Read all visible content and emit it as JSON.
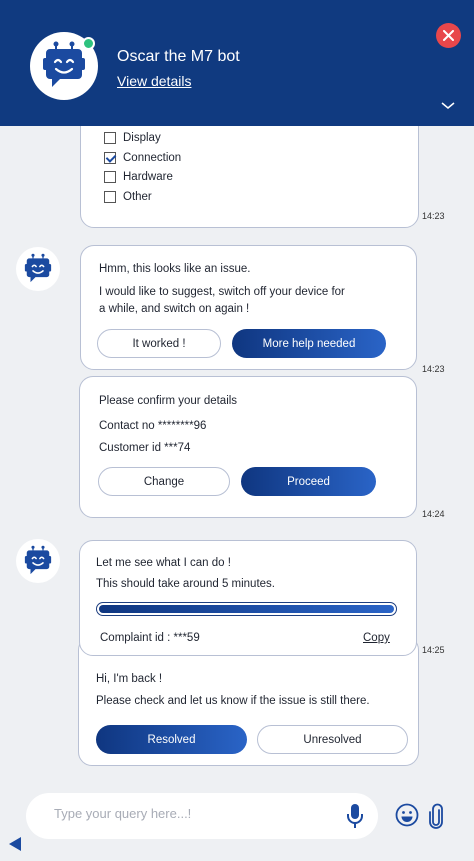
{
  "header": {
    "bot_name": "Oscar the M7 bot",
    "view_details": "View details",
    "online_color": "#2ec27e",
    "close_color": "#e8474b",
    "icons": [
      "bot-avatar-icon",
      "close-icon",
      "chevron-down-icon"
    ]
  },
  "issue_options": {
    "items": [
      {
        "label": "Display",
        "checked": false
      },
      {
        "label": "Connection",
        "checked": true
      },
      {
        "label": "Hardware",
        "checked": false
      },
      {
        "label": "Other",
        "checked": false
      }
    ],
    "time": "14:23"
  },
  "suggestion": {
    "line1": "Hmm, this looks like an issue.",
    "line2": "I would like to suggest, switch off your device for",
    "line3": "a while, and switch on again !",
    "btn_worked": "It worked !",
    "btn_more_help": "More help needed",
    "time": "14:23"
  },
  "confirm": {
    "title": "Please confirm your details",
    "contact": "Contact no ********96",
    "customer": "Customer id ***74",
    "btn_change": "Change",
    "btn_proceed": "Proceed",
    "time": "14:24"
  },
  "progress_msg": {
    "line1": "Let me see what I can do !",
    "line2": "This should take around 5 minutes.",
    "progress": 1.0,
    "complaint": "Complaint id : ***59",
    "copy": "Copy",
    "time": "14:25"
  },
  "back_msg": {
    "line1": "Hi, I'm back !",
    "line2": "Please check and let us know if the issue is still there.",
    "btn_resolved": "Resolved",
    "btn_unresolved": "Unresolved"
  },
  "composer": {
    "placeholder": "Type your query here...!",
    "icons": [
      "microphone-icon",
      "emoji-icon",
      "paperclip-icon",
      "back-arrow-icon"
    ]
  },
  "colors": {
    "header_bg": "#103a80",
    "accent_start": "#0f3680",
    "accent_end": "#2a64c7"
  }
}
